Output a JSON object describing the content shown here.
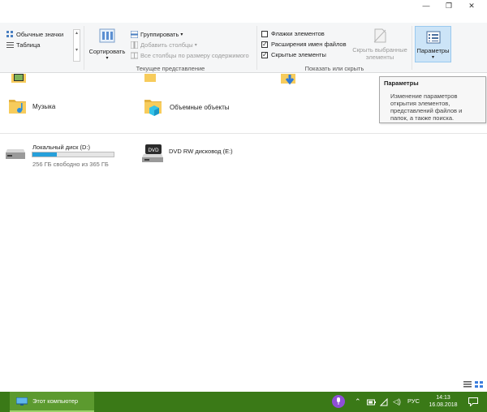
{
  "window": {
    "minimize": "—",
    "maximize": "❐",
    "close": "✕"
  },
  "ribbon": {
    "layout": {
      "large_icons": "Обычные значки",
      "table": "Таблица"
    },
    "current_view": {
      "sort_label": "Сортировать",
      "group_by": "Группировать",
      "add_columns": "Добавить столбцы",
      "fit_columns": "Все столбцы по размеру содержимого",
      "group_label": "Текущее представление"
    },
    "show_hide": {
      "item_checkboxes": {
        "label": "Флажки элементов",
        "checked": false
      },
      "file_extensions": {
        "label": "Расширения имен файлов",
        "checked": true
      },
      "hidden_items": {
        "label": "Скрытые элементы",
        "checked": true
      },
      "hide_selected": "Скрыть выбранные элементы",
      "group_label": "Показать или скрыть"
    },
    "options": {
      "label": "Параметры",
      "arrow": "▾"
    }
  },
  "tooltip": {
    "title": "Параметры",
    "text": "Изменение параметров открытия элементов, представлений файлов и папок, а также поиска."
  },
  "folders": [
    {
      "name": "Музыка"
    },
    {
      "name": "Объемные объекты"
    }
  ],
  "drives": [
    {
      "name": "Локальный диск (D:)",
      "free": "256 ГБ свободно из 365 ГБ",
      "used_fraction": 0.3
    },
    {
      "name": "DVD RW дисковод (E:)"
    }
  ],
  "taskbar": {
    "active_window": "Этот компьютер",
    "language": "РУС",
    "time": "14:13",
    "date": "16.08.2018"
  },
  "colors": {
    "taskbar": "#3a7917",
    "taskbar_active": "#5c9a2f",
    "drive_fill": "#26a0da",
    "params_button": "#cce4f7",
    "folder": "#f7cc5c"
  }
}
